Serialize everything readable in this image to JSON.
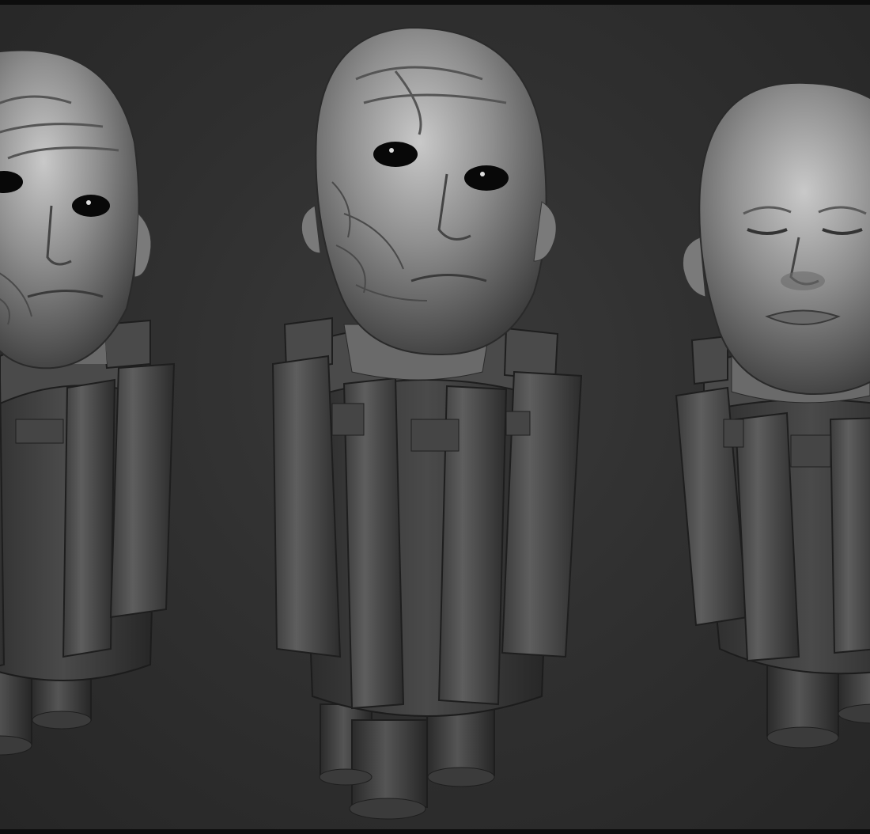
{
  "scene": {
    "background_color": "#2f2f2f",
    "material_color": "#8a8a8a",
    "busts": [
      {
        "id": "left",
        "face": "scarred-half",
        "eyes": "open-black",
        "cropped": "left-edge"
      },
      {
        "id": "center",
        "face": "scarred-half",
        "eyes": "open-black",
        "cropped": "none"
      },
      {
        "id": "right",
        "face": "smooth",
        "eyes": "closed",
        "cropped": "right-edge"
      }
    ]
  }
}
